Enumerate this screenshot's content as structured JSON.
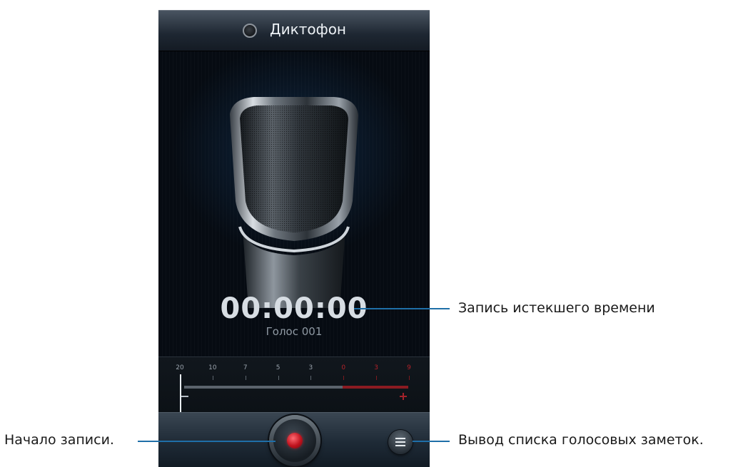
{
  "app": {
    "title": "Диктофон"
  },
  "recording": {
    "elapsed_time": "00:00:00",
    "file_name": "Голос 001"
  },
  "level_meter": {
    "tick_labels": [
      "20",
      "10",
      "7",
      "5",
      "3",
      "0",
      "3",
      "9"
    ],
    "red_from_index": 5,
    "current_level": 0,
    "minus_symbol": "–",
    "plus_symbol": "+"
  },
  "controls": {
    "record_icon": "record-icon",
    "list_icon": "list-icon"
  },
  "callouts": {
    "elapsed_time": "Запись истекшего времени",
    "record": "Начало записи.",
    "list": "Вывод списка голосовых заметок."
  },
  "colors": {
    "accent_red": "#c0131e",
    "callout_blue": "#1f6fa8",
    "background": "#0b1118"
  }
}
